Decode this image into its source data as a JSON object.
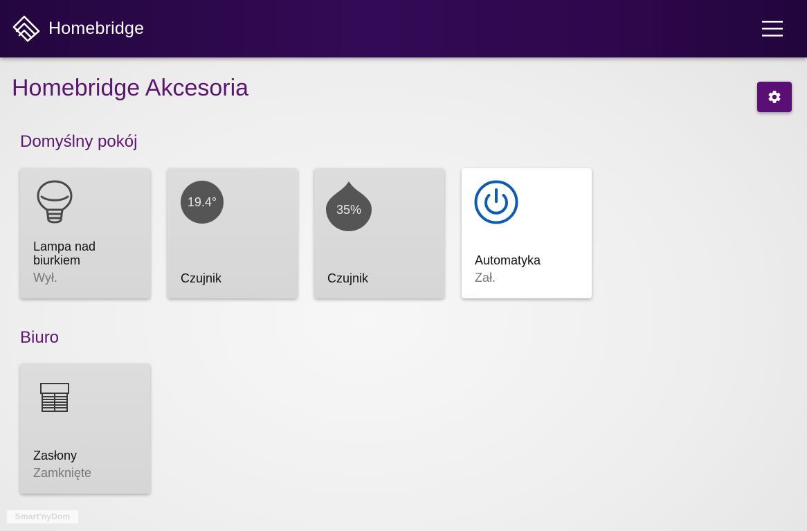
{
  "app": {
    "name": "Homebridge",
    "logo_icon": "homebridge-logo-icon",
    "menu_icon": "hamburger-menu-icon"
  },
  "page": {
    "title": "Homebridge Akcesoria",
    "settings_icon": "gear-icon"
  },
  "colors": {
    "navbar": "#2e074d",
    "accent": "#5b1670",
    "power_on": "#0a5cb4",
    "tile_off": "#d8d8d8",
    "tile_on": "#ffffff"
  },
  "rooms": [
    {
      "name": "Domyślny pokój",
      "accessories": [
        {
          "icon": "lightbulb-icon",
          "name": "Lampa nad biurkiem",
          "status": "Wył.",
          "active": false
        },
        {
          "icon": "thermometer-icon",
          "value": "19.4°",
          "name": "Czujnik",
          "active": false
        },
        {
          "icon": "humidity-drop-icon",
          "value": "35%",
          "name": "Czujnik",
          "active": false
        },
        {
          "icon": "power-icon",
          "name": "Automatyka",
          "status": "Zał.",
          "active": true
        }
      ]
    },
    {
      "name": "Biuro",
      "accessories": [
        {
          "icon": "window-blinds-icon",
          "name": "Zasłony",
          "status": "Zamknięte",
          "active": false
        }
      ]
    }
  ],
  "watermark": "Smart'nyDom"
}
